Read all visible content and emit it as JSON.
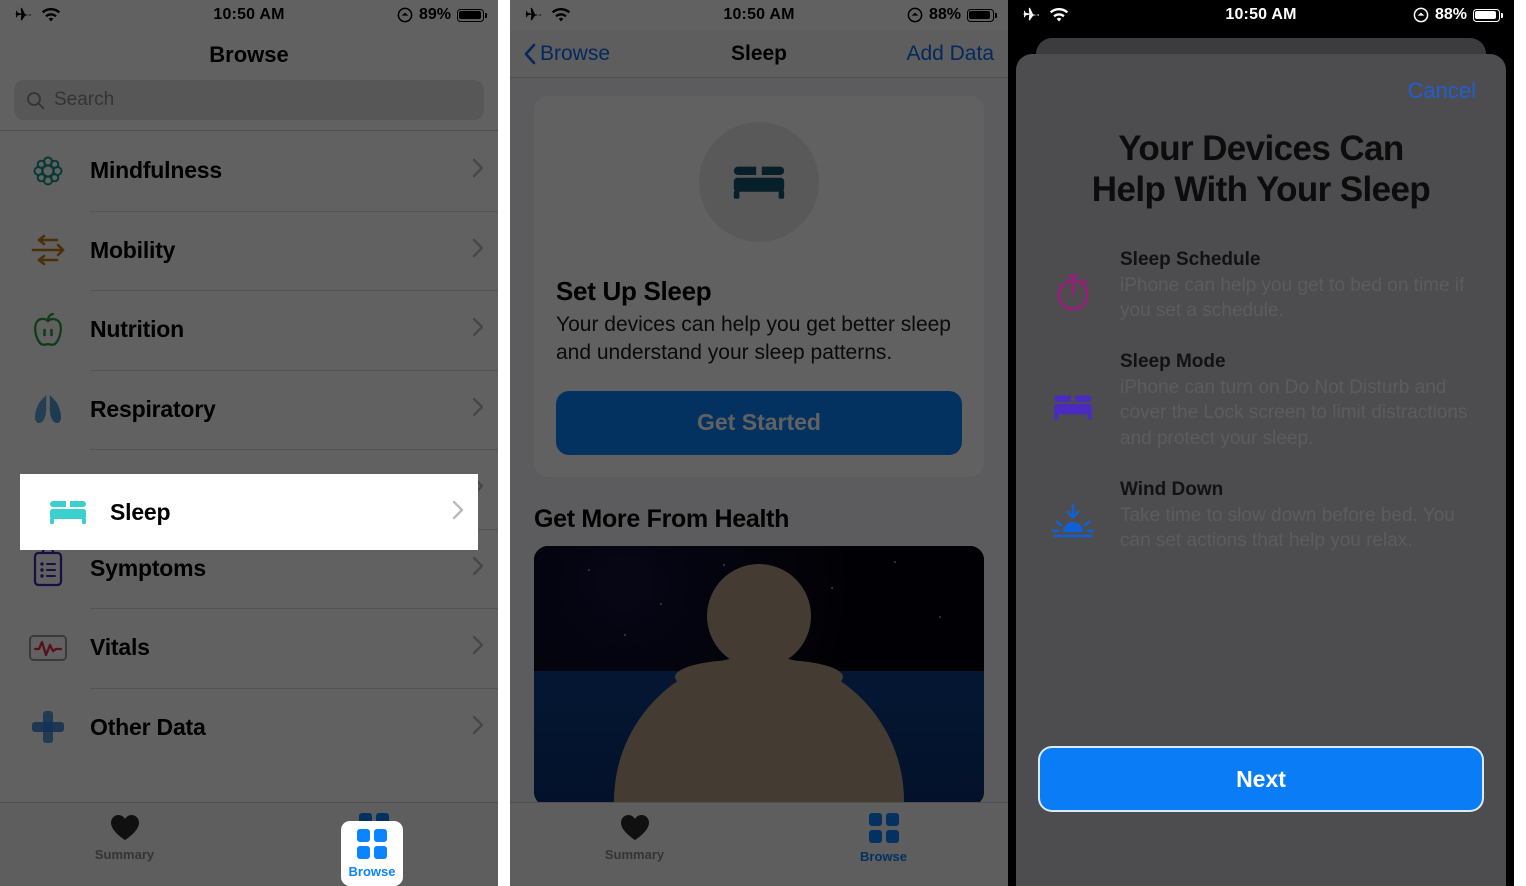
{
  "panel1": {
    "status": {
      "time": "10:50 AM",
      "battery": "89%",
      "airplane_icon": "airplane-icon",
      "wifi_icon": "wifi-icon",
      "battery_icon": "battery-icon",
      "focus_icon": "do-not-disturb-icon"
    },
    "nav": {
      "title": "Browse"
    },
    "search": {
      "placeholder": "Search",
      "icon": "search-icon"
    },
    "list": [
      {
        "label": "Mindfulness",
        "icon": "mindfulness-icon",
        "color": "#17958c"
      },
      {
        "label": "Mobility",
        "icon": "mobility-icon",
        "color": "#c67b12"
      },
      {
        "label": "Nutrition",
        "icon": "nutrition-icon",
        "color": "#2a9d3f"
      },
      {
        "label": "Respiratory",
        "icon": "respiratory-icon",
        "color": "#4e9ed4"
      },
      {
        "label": "Sleep",
        "icon": "sleep-bed-icon",
        "color": "#3ad0cd"
      },
      {
        "label": "Symptoms",
        "icon": "symptoms-icon",
        "color": "#3e2fa8"
      },
      {
        "label": "Vitals",
        "icon": "vitals-icon",
        "color": "#e03050"
      },
      {
        "label": "Other Data",
        "icon": "other-data-icon",
        "color": "#2f7fd6"
      }
    ],
    "highlighted_row": "Sleep",
    "tabs": [
      {
        "label": "Summary",
        "icon": "heart-icon",
        "active": false
      },
      {
        "label": "Browse",
        "icon": "grid-icon",
        "active": true
      }
    ]
  },
  "panel2": {
    "status": {
      "time": "10:50 AM",
      "battery": "88%"
    },
    "nav": {
      "back": "Browse",
      "title": "Sleep",
      "action": "Add Data",
      "back_icon": "chevron-left-icon"
    },
    "card": {
      "icon": "bed-icon",
      "title": "Set Up Sleep",
      "body": "Your devices can help you get better sleep and understand your sleep patterns.",
      "button": "Get Started"
    },
    "section": {
      "title": "Get More From Health",
      "promo_alt": "night-meditation-image"
    },
    "tabs": [
      {
        "label": "Summary",
        "active": false
      },
      {
        "label": "Browse",
        "active": true
      }
    ]
  },
  "panel3": {
    "status": {
      "time": "10:50 AM",
      "battery": "88%"
    },
    "sheet": {
      "cancel": "Cancel",
      "heading_line1": "Your Devices Can",
      "heading_line2": "Help With Your Sleep",
      "features": [
        {
          "icon": "stopwatch-icon",
          "color": "#9b1b7e",
          "title": "Sleep Schedule",
          "desc": "iPhone can help you get to bed on time if you set a schedule."
        },
        {
          "icon": "bed-icon",
          "color": "#4b2bbf",
          "title": "Sleep Mode",
          "desc": "iPhone can turn on Do Not Disturb and cover the Lock screen to limit distractions and protect your sleep."
        },
        {
          "icon": "wind-down-sunset-icon",
          "color": "#1060d6",
          "title": "Wind Down",
          "desc": "Take time to slow down before bed. You can set actions that help you relax."
        }
      ],
      "next": "Next"
    }
  },
  "colors": {
    "accent_blue": "#0a84ff",
    "link_blue": "#0a6cf1",
    "dim": "rgba(0,0,0,0.62)"
  }
}
